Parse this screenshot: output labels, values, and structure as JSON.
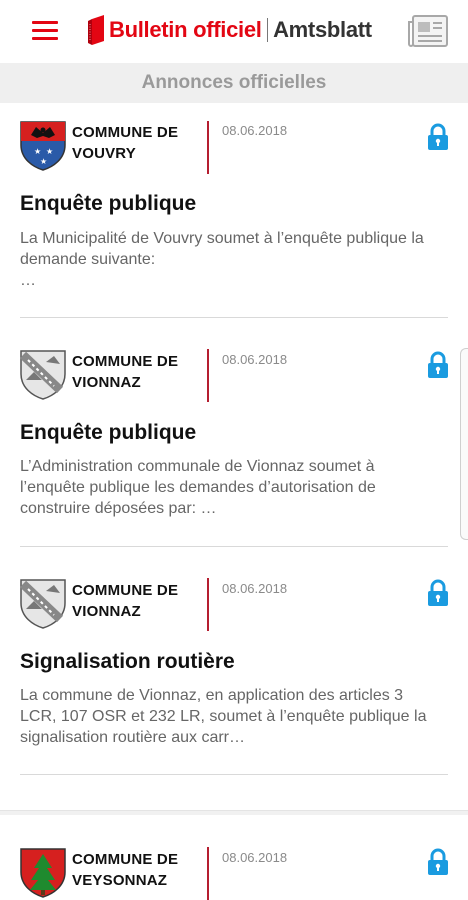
{
  "header": {
    "logo_part1": "Bulletin officiel",
    "logo_part2": "Amtsblatt",
    "brand_color": "#e30613",
    "menu_icon": "hamburger-menu-icon",
    "newspaper_icon": "newspaper-icon"
  },
  "section": {
    "title": "Annonces officielles"
  },
  "announcements": [
    {
      "commune_line1": "COMMUNE DE",
      "commune_line2": "VOUVRY",
      "date": "08.06.2018",
      "title": "Enquête publique",
      "excerpt": "La Municipalité de Vouvry soumet à l’enquête publique la demande suivante:\n …",
      "crest_icon": "vouvry-crest-icon",
      "lock_icon": "lock-icon"
    },
    {
      "commune_line1": "COMMUNE DE",
      "commune_line2": "VIONNAZ",
      "date": "08.06.2018",
      "title": "Enquête publique",
      "excerpt": "L’Administration communale de Vionnaz soumet à l’enquête publique les demandes d’autorisation de construire déposées par: …",
      "crest_icon": "vionnaz-crest-icon",
      "lock_icon": "lock-icon"
    },
    {
      "commune_line1": "COMMUNE DE",
      "commune_line2": "VIONNAZ",
      "date": "08.06.2018",
      "title": "Signalisation routière",
      "excerpt": "La commune de Vionnaz, en application des articles 3 LCR, 107 OSR et 232 LR, soumet à l’enquête publique la signalisation routière aux carr…",
      "crest_icon": "vionnaz-crest-icon",
      "lock_icon": "lock-icon"
    },
    {
      "commune_line1": "COMMUNE DE",
      "commune_line2": "VEYSONNAZ",
      "date": "08.06.2018",
      "crest_icon": "veysonnaz-crest-icon",
      "lock_icon": "lock-icon"
    }
  ],
  "colors": {
    "accent_line": "#b51e30",
    "lock": "#1a9be0",
    "section_bg": "#efefef"
  }
}
